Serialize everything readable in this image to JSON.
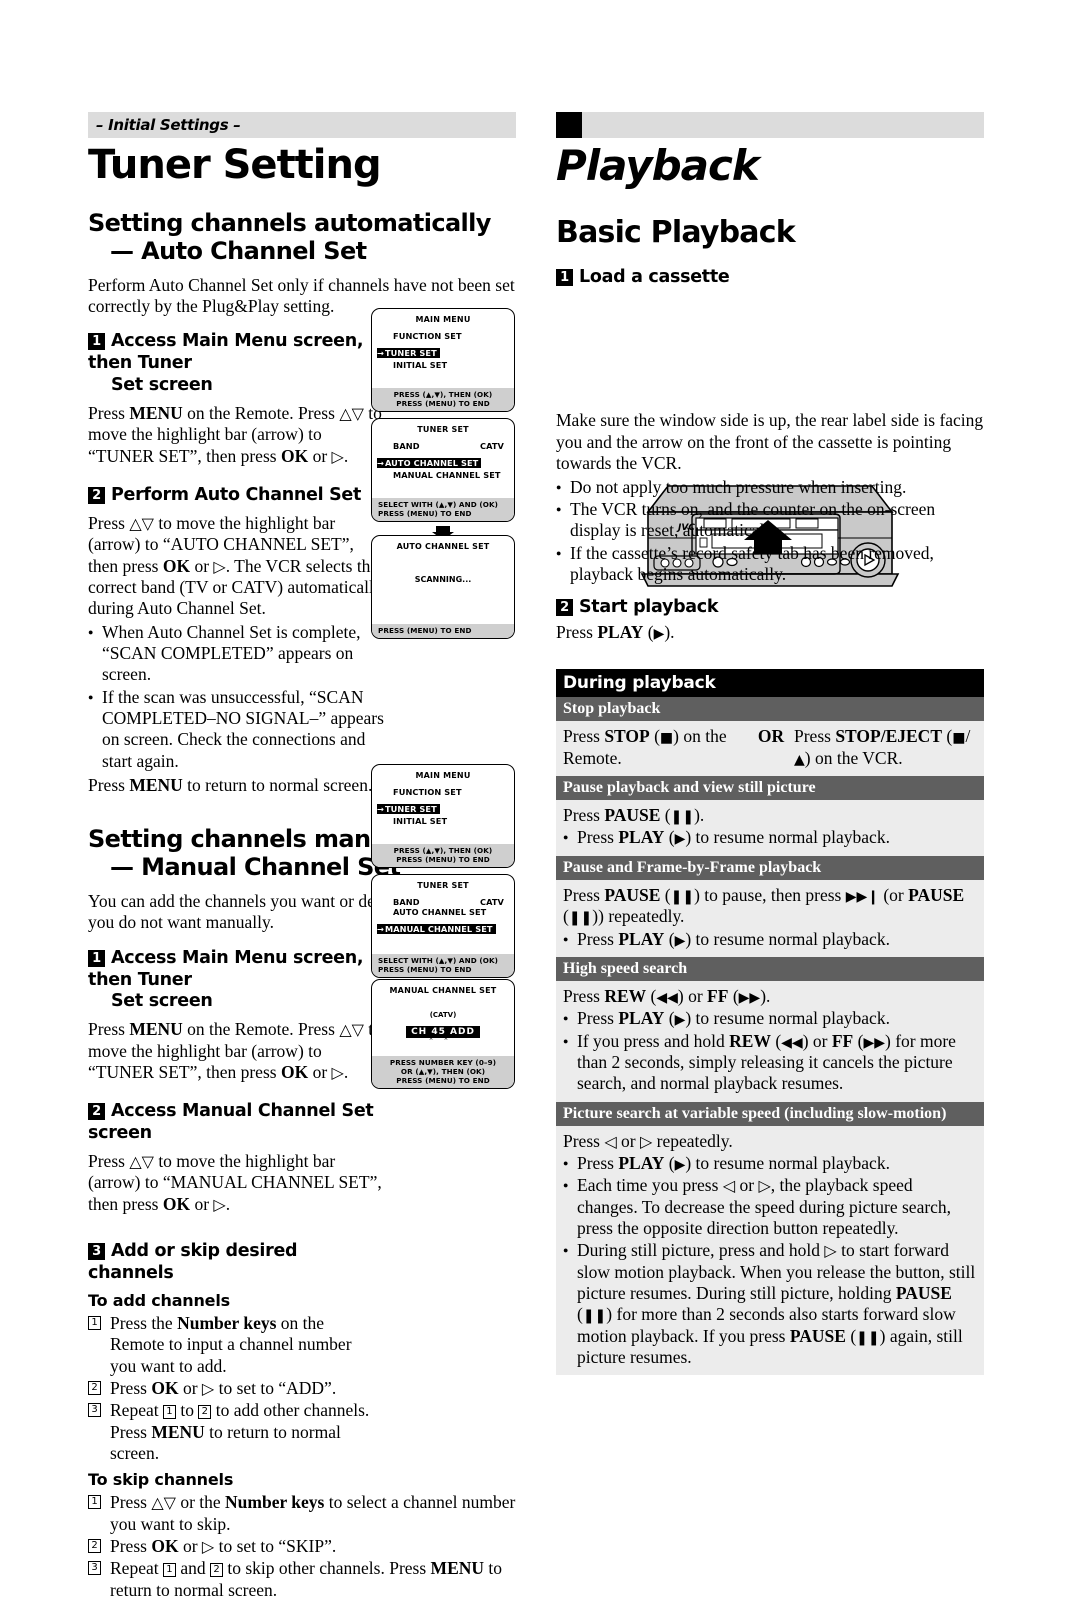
{
  "left": {
    "kicker": "– Initial Settings –",
    "title": "Tuner Setting",
    "sec1": {
      "l1": "Setting channels automatically",
      "l2": "— Auto Channel Set"
    },
    "sec1_intro": "Perform Auto Channel Set only if channels have not been set correctly by the Plug&Play setting.",
    "step1": {
      "num": "1",
      "l1": "Access Main Menu screen, then Tuner",
      "l2": "Set screen"
    },
    "step1_body_a": "Press ",
    "step1_body_menu": "MENU",
    "step1_body_b": " on the Remote. Press ",
    "step1_updown": "△▽",
    "step1_body_c": " to move the highlight bar (arrow) to “TUNER SET”, then press ",
    "step1_ok": "OK",
    "step1_body_d": " or ",
    "step1_right": "▷",
    "step1_body_e": ".",
    "step2": {
      "num": "2",
      "l1": "Perform Auto Channel Set"
    },
    "step2_p1": "Press △▽ to move the highlight bar (arrow) to “AUTO CHANNEL SET”, then press OK or ▷. The VCR selects the correct band (TV or CATV) automatically during Auto Channel Set.",
    "step2_b1": "When Auto Channel Set is complete, “SCAN COMPLETED” appears on screen.",
    "step2_b2": "If the scan was unsuccessful, “SCAN COMPLETED–NO SIGNAL–” appears on screen. Check the connections and start again.",
    "step2_end_a": "Press ",
    "step2_end_menu": "MENU",
    "step2_end_b": " to return to normal screen.",
    "sec2": {
      "l1": "Setting channels manually",
      "l2": "— Manual Channel Set"
    },
    "sec2_intro": "You can add the channels you want or delete the channels you do not want manually.",
    "m_step1": {
      "num": "1",
      "l1": "Access Main Menu screen, then Tuner",
      "l2": "Set screen"
    },
    "m_step2": {
      "num": "2",
      "l1": "Access Manual Channel Set screen"
    },
    "m_step2_p": "Press △▽ to move the highlight bar (arrow) to “MANUAL CHANNEL SET”, then press OK or ▷.",
    "m_step3": {
      "num": "3",
      "l1": "Add or skip desired channels"
    },
    "to_add": "To add channels",
    "add_1_a": "Press the ",
    "add_1_b": "Number keys",
    "add_1_c": " on the Remote to input a channel number you want to add.",
    "add_2_a": "Press ",
    "add_2_ok": "OK",
    "add_2_b": " or ▷ to set to “ADD”.",
    "add_3_a": "Repeat ",
    "add_3_b": " to ",
    "add_3_c": " to add other channels.",
    "add_3_d": "Press MENU to return to normal screen.",
    "to_skip": "To skip channels",
    "skip_1_a": "Press △▽ or the ",
    "skip_1_b": "Number keys",
    "skip_1_c": " to select a channel number you want to skip.",
    "skip_2_a": "Press ",
    "skip_2_ok": "OK",
    "skip_2_b": " or ▷ to set to “SKIP”.",
    "skip_3_a": "Repeat ",
    "skip_3_b": " and ",
    "skip_3_c": " to skip other channels. Press MENU to return to normal screen."
  },
  "osd": {
    "main_menu": {
      "title": "MAIN MENU",
      "rows": [
        "FUNCTION SET",
        "TUNER SET",
        "INITIAL SET"
      ],
      "highlight": "TUNER SET",
      "foot1": "PRESS (▲,▼), THEN (OK)",
      "foot2": "PRESS (MENU) TO END"
    },
    "tuner_set_auto": {
      "title": "TUNER SET",
      "row_band_label": "BAND",
      "row_band_value": "CATV",
      "rows": [
        "AUTO CHANNEL SET",
        "MANUAL CHANNEL SET"
      ],
      "highlight": "AUTO CHANNEL SET",
      "foot1": "SELECT WITH (▲,▼) AND (OK)",
      "foot2": "PRESS (MENU) TO END"
    },
    "auto_channel_set": {
      "title": "AUTO CHANNEL SET",
      "message": "SCANNING...",
      "foot1": "PRESS (MENU) TO END"
    },
    "tuner_set_manual": {
      "title": "TUNER SET",
      "row_band_label": "BAND",
      "row_band_value": "CATV",
      "rows": [
        "AUTO CHANNEL SET",
        "MANUAL CHANNEL SET"
      ],
      "highlight": "MANUAL CHANNEL SET",
      "foot1": "SELECT WITH (▲,▼) AND (OK)",
      "foot2": "PRESS (MENU) TO END"
    },
    "manual_channel_set": {
      "title": "MANUAL CHANNEL SET",
      "catv": "(CATV)",
      "ch_label": "CH",
      "ch_number": "45",
      "ch_state": "ADD",
      "foot1": "PRESS NUMBER KEY (0–9)",
      "foot2": "OR (▲,▼), THEN (OK)",
      "foot3": "PRESS (MENU) TO END"
    }
  },
  "right": {
    "title": "Playback",
    "sec1": "Basic Playback",
    "step1": {
      "num": "1",
      "l1": "Load a cassette"
    },
    "vcr_brand": "JVC",
    "p_intro": "Make sure the window side is up, the rear label side is facing you and the arrow on the front of the cassette is pointing towards the VCR.",
    "b1": "Do not apply too much pressure when inserting.",
    "b2": "The VCR turns on, and the counter on the on-screen display is reset, automatically.",
    "b3": "If the cassette’s record safety tab has been removed, playback begins automatically.",
    "step2": {
      "num": "2",
      "l1": "Start playback"
    },
    "step2_p_a": "Press ",
    "step2_p_b": "PLAY",
    "step2_p_c": " (▶).",
    "table": {
      "header": "During playback",
      "rows": [
        {
          "head": "Stop playback",
          "split": true,
          "c1_a": "Press ",
          "c1_b": "STOP",
          "c1_c": " (■) on the Remote.",
          "or": "OR",
          "c2_a": "Press ",
          "c2_b": "STOP/EJECT",
          "c2_c": " (■/▲) on the VCR."
        },
        {
          "head": "Pause playback and view still picture",
          "p_a": "Press ",
          "p_b": "PAUSE",
          "p_c": " (❚❚).",
          "bullets": [
            {
              "a": "Press ",
              "b": "PLAY",
              "c": " (▶) to resume normal playback."
            }
          ]
        },
        {
          "head": "Pause and Frame-by-Frame playback",
          "p_a": "Press ",
          "p_b": "PAUSE",
          "p_c": " (❚❚) to pause, then press ▶▶❙ (or PAUSE (❚❚)) repeatedly.",
          "bullets": [
            {
              "a": "Press ",
              "b": "PLAY",
              "c": " (▶) to resume normal playback."
            }
          ]
        },
        {
          "head": "High speed search",
          "p_a": "Press ",
          "p_b": "REW",
          "p_c": " (◀◀) or FF (▶▶).",
          "bullets": [
            {
              "a": "Press ",
              "b": "PLAY",
              "c": " (▶) to resume normal playback."
            },
            {
              "a": "If you press and hold ",
              "b": "REW",
              "c": " (◀◀) or FF (▶▶) for more than 2 seconds, simply releasing it cancels the picture search, and normal playback resumes."
            }
          ]
        },
        {
          "head": "Picture search at variable speed (including slow-motion)",
          "p_a": "Press ",
          "p_b": "◁",
          "p_c": " or ▷ repeatedly.",
          "bullets": [
            {
              "a": "Press ",
              "b": "PLAY",
              "c": " (▶) to resume normal playback."
            },
            {
              "a": "Each time you press ◁ or ▷, the playback speed changes. To decrease the speed during picture search, press the opposite direction button repeatedly.",
              "b": "",
              "c": ""
            },
            {
              "a": "During still picture, press and hold ▷ to start forward slow motion playback. When you release the button, still picture resumes. During still picture, holding ",
              "b": "PAUSE",
              "c": " (❚❚) for more than 2 seconds also starts forward slow motion playback. If you press PAUSE (❚❚) again, still picture resumes."
            }
          ]
        }
      ]
    }
  },
  "colors": {
    "bar_gray": "#dcdcdc",
    "table_head_black": "#000000",
    "table_subhead_gray": "#5f5f5f",
    "table_cell_gray": "#ececec",
    "osd_foot_gray": "#cfcfcf"
  }
}
